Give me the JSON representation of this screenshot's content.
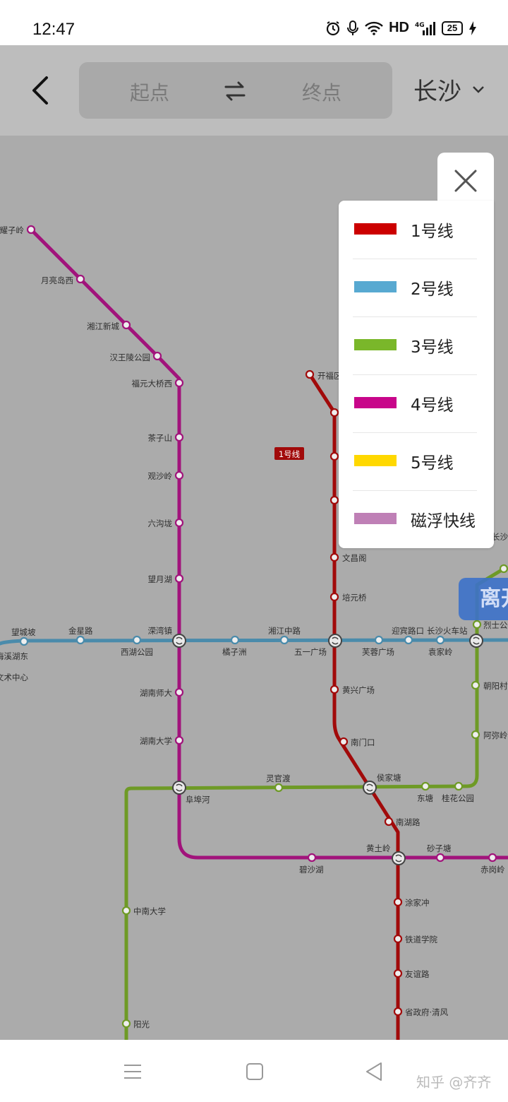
{
  "status_bar": {
    "time": "12:47",
    "hd": "HD",
    "network": "4G",
    "battery": "25"
  },
  "header": {
    "start_placeholder": "起点",
    "end_placeholder": "终点",
    "city": "长沙"
  },
  "map": {
    "line_badge": "1号线",
    "stations": {
      "s1": "耀子岭",
      "s2": "月亮岛西",
      "s3": "湘江新城",
      "s4": "汉王陵公园",
      "s5": "福元大桥西",
      "s6": "茶子山",
      "s7": "观沙岭",
      "s8": "六沟垅",
      "s9": "望月湖",
      "s10": "溁湾镇",
      "s11": "湖南师大",
      "s12": "湖南大学",
      "s13": "阜埠河",
      "s14": "碧沙湖",
      "s15": "黄土岭",
      "s16": "砂子塘",
      "s17": "赤岗岭",
      "s18": "中南大学",
      "s19": "阳光",
      "s20": "开福区",
      "s21": "文昌阁",
      "s22": "培元桥",
      "s23": "五一广场",
      "s24": "黄兴广场",
      "s25": "南门口",
      "s26": "侯家塘",
      "s27": "南湖路",
      "s28": "涂家冲",
      "s29": "铁道学院",
      "s30": "友谊路",
      "s31": "省政府·清风",
      "s32": "望城坡",
      "s33": "金星路",
      "s34": "西湖公园",
      "s35": "湘江中路",
      "s36": "橘子洲",
      "s37": "芙蓉广场",
      "s38": "迎宾路口",
      "s39": "长沙火车站",
      "s40": "袁家岭",
      "s41": "梅溪湖东",
      "s42": "文术中心",
      "s43": "灵官渡",
      "s44": "东塘",
      "s45": "桂花公园",
      "s46": "烈士公",
      "s47": "朝阳村",
      "s48": "阿弥岭",
      "s49": "长沙"
    }
  },
  "legend": {
    "items": [
      {
        "label": "1号线",
        "color": "#cc0000"
      },
      {
        "label": "2号线",
        "color": "#58a9d1"
      },
      {
        "label": "3号线",
        "color": "#7ab72a"
      },
      {
        "label": "4号线",
        "color": "#c8068a"
      },
      {
        "label": "5号线",
        "color": "#ffd800"
      },
      {
        "label": "磁浮快线",
        "color": "#bf80b6"
      }
    ]
  },
  "exit_button": "离开",
  "watermark": "知乎 @齐齐",
  "icons": {
    "back": "back-arrow-icon",
    "swap": "swap-icon",
    "close": "close-icon",
    "dropdown": "chevron-down-icon"
  }
}
